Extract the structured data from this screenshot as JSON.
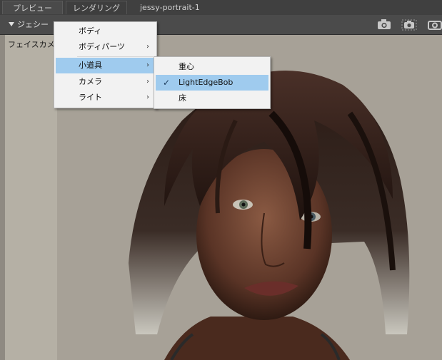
{
  "tabs": [
    {
      "label": "プレビュー"
    },
    {
      "label": "レンダリング"
    },
    {
      "label": "jessy-portrait-1"
    }
  ],
  "toolbar": {
    "figure_label": "ジェシー",
    "icons": [
      "camera-icon",
      "camera-select-icon",
      "camera-partial-icon"
    ]
  },
  "viewport": {
    "camera_label": "フェイスカメラ"
  },
  "context_menu": {
    "items": [
      {
        "label": "ボディ",
        "has_submenu": false
      },
      {
        "label": "ボディパーツ",
        "has_submenu": true
      },
      {
        "label": "小道具",
        "has_submenu": true,
        "highlighted": true
      },
      {
        "label": "カメラ",
        "has_submenu": true
      },
      {
        "label": "ライト",
        "has_submenu": true
      }
    ]
  },
  "props_submenu": {
    "items": [
      {
        "label": "重心",
        "checked": false
      },
      {
        "label": "LightEdgeBob",
        "checked": true,
        "highlighted": true
      },
      {
        "label": "床",
        "checked": false
      }
    ]
  },
  "colors": {
    "menu_highlight": "#9fcbee",
    "viewport_bg": "#a7a197",
    "toolbar_bg": "#4b4b4b"
  }
}
